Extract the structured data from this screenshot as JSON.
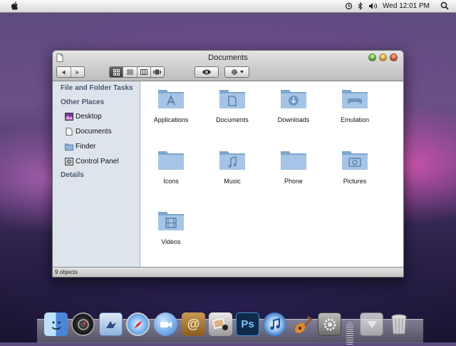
{
  "menubar": {
    "apple_icon": "apple-logo-icon",
    "clock": "Wed 12:01 PM",
    "status_icons": [
      "time-machine-icon",
      "bluetooth-icon",
      "volume-icon",
      "spotlight-search-icon"
    ]
  },
  "window": {
    "title": "Documents",
    "toolbar": {
      "nav": [
        "back-arrow-icon",
        "forward-arrow-icon"
      ],
      "view_modes": [
        "icon-view-icon",
        "list-view-icon",
        "column-view-icon",
        "coverflow-view-icon"
      ],
      "active_view": "icon-view-icon",
      "quicklook": "eye-icon",
      "action": "gear-icon"
    },
    "sidebar": {
      "task_heading": "File and Folder Tasks",
      "places_heading": "Other Places",
      "places": [
        {
          "label": "Desktop",
          "icon": "desktop-icon"
        },
        {
          "label": "Documents",
          "icon": "document-icon"
        },
        {
          "label": "Finder",
          "icon": "folder-icon"
        },
        {
          "label": "Control Panel",
          "icon": "control-panel-icon"
        }
      ],
      "details_heading": "Details"
    },
    "items": [
      {
        "label": "Applications",
        "icon": "applications-folder-icon"
      },
      {
        "label": "Documents",
        "icon": "documents-folder-icon"
      },
      {
        "label": "Downloads",
        "icon": "downloads-folder-icon"
      },
      {
        "label": "Emulation",
        "icon": "gamepad-folder-icon"
      },
      {
        "label": "Icons",
        "icon": "folder-icon"
      },
      {
        "label": "Music",
        "icon": "music-folder-icon"
      },
      {
        "label": "Phone",
        "icon": "folder-icon"
      },
      {
        "label": "Pictures",
        "icon": "pictures-folder-icon"
      },
      {
        "label": "Videos",
        "icon": "videos-folder-icon"
      }
    ],
    "status": "9 objects"
  },
  "dock": {
    "apps": [
      "finder-icon",
      "dashboard-icon",
      "mail-icon",
      "safari-icon",
      "ichat-icon",
      "address-book-icon",
      "iphoto-icon",
      "photoshop-icon",
      "itunes-icon",
      "garageband-icon",
      "system-preferences-icon",
      "downloads-stack-icon",
      "trash-icon"
    ],
    "photoshop_label": "Ps",
    "address_book_label": "@"
  },
  "colors": {
    "sidebar_bg": "#dde4ec",
    "folder_blue": "#8fb3d9",
    "heading_text": "#4a5a70"
  }
}
